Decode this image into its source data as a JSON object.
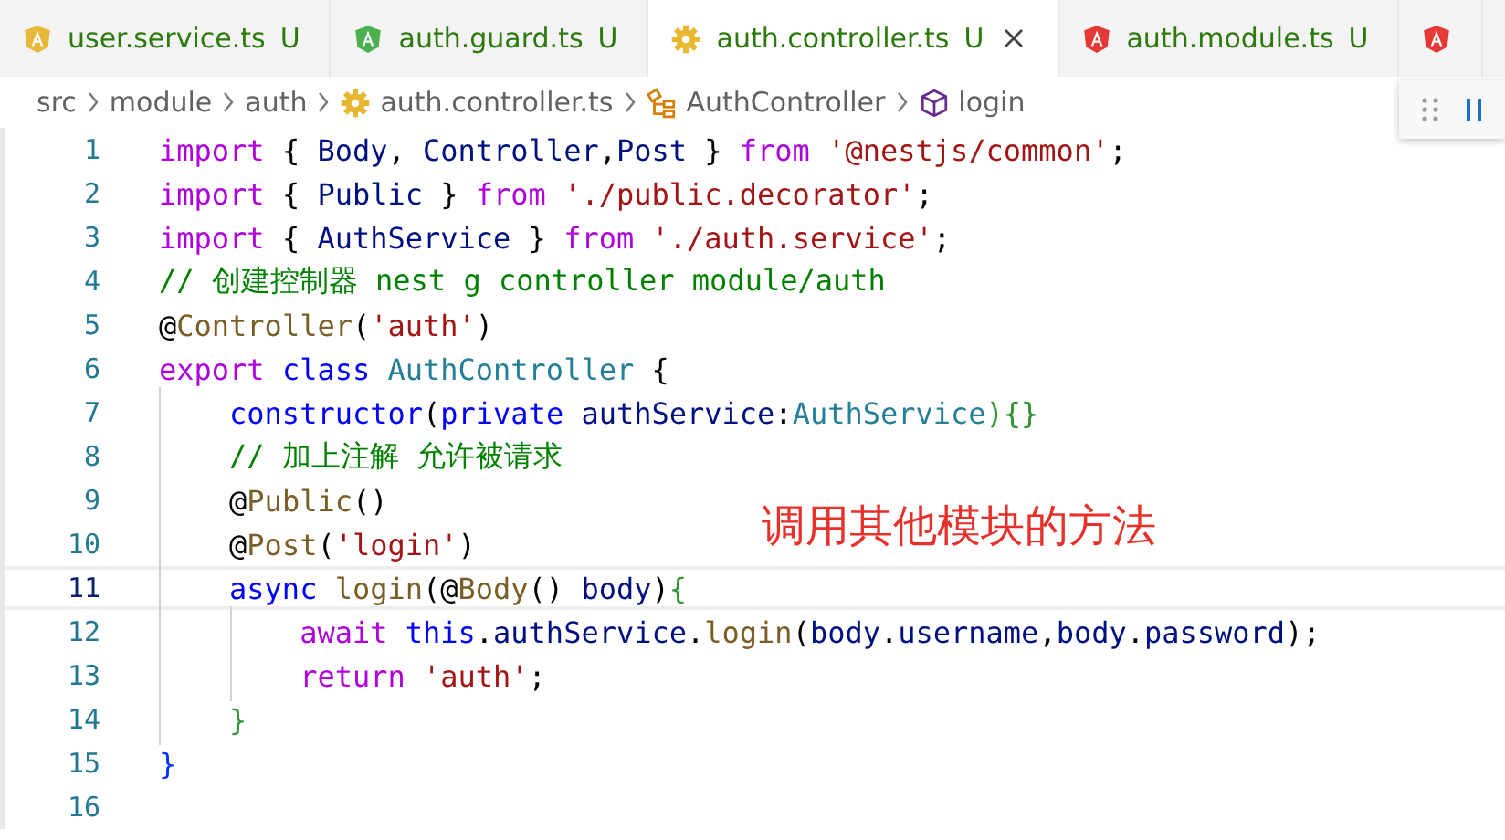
{
  "tabs": [
    {
      "label": "user.service.ts",
      "status": "U",
      "kind": "angular",
      "color": "#e8b73a",
      "selected": false
    },
    {
      "label": "auth.guard.ts",
      "status": "U",
      "kind": "angular",
      "color": "#4caf50",
      "selected": false
    },
    {
      "label": "auth.controller.ts",
      "status": "U",
      "kind": "gear",
      "color": "#e8b730",
      "selected": true
    },
    {
      "label": "auth.module.ts",
      "status": "U",
      "kind": "angular",
      "color": "#e53935",
      "selected": false
    },
    {
      "kind": "angular",
      "color": "#e53935",
      "selected": false
    }
  ],
  "breadcrumb": [
    {
      "label": "src",
      "kind": "folder"
    },
    {
      "label": "module",
      "kind": "folder"
    },
    {
      "label": "auth",
      "kind": "folder"
    },
    {
      "label": "auth.controller.ts",
      "kind": "file"
    },
    {
      "label": "AuthController",
      "kind": "class"
    },
    {
      "label": "login",
      "kind": "method"
    }
  ],
  "editor": {
    "lines": [
      {
        "number": "1",
        "active": false,
        "tokens": [
          {
            "text": "import ",
            "kind": "keyword"
          },
          {
            "text": "{ ",
            "kind": "plain"
          },
          {
            "text": "Body",
            "kind": "variable"
          },
          {
            "text": ", ",
            "kind": "plain"
          },
          {
            "text": "Controller",
            "kind": "variable"
          },
          {
            "text": ",",
            "kind": "plain"
          },
          {
            "text": "Post",
            "kind": "variable"
          },
          {
            "text": " } ",
            "kind": "plain"
          },
          {
            "text": "from ",
            "kind": "keyword"
          },
          {
            "text": "'@nestjs/common'",
            "kind": "string"
          },
          {
            "text": ";",
            "kind": "plain"
          }
        ]
      },
      {
        "number": "2",
        "active": false,
        "tokens": [
          {
            "text": "import ",
            "kind": "keyword"
          },
          {
            "text": "{ ",
            "kind": "plain"
          },
          {
            "text": "Public",
            "kind": "variable"
          },
          {
            "text": " } ",
            "kind": "plain"
          },
          {
            "text": "from ",
            "kind": "keyword"
          },
          {
            "text": "'./public.decorator'",
            "kind": "string"
          },
          {
            "text": ";",
            "kind": "plain"
          }
        ]
      },
      {
        "number": "3",
        "active": false,
        "tokens": [
          {
            "text": "import ",
            "kind": "keyword"
          },
          {
            "text": "{ ",
            "kind": "plain"
          },
          {
            "text": "AuthService",
            "kind": "variable"
          },
          {
            "text": " } ",
            "kind": "plain"
          },
          {
            "text": "from ",
            "kind": "keyword"
          },
          {
            "text": "'./auth.service'",
            "kind": "string"
          },
          {
            "text": ";",
            "kind": "plain"
          }
        ]
      },
      {
        "number": "4",
        "active": false,
        "tokens": [
          {
            "text": "// 创建控制器 nest g controller module/auth",
            "kind": "comment"
          }
        ]
      },
      {
        "number": "5",
        "active": false,
        "tokens": [
          {
            "text": "@",
            "kind": "plain"
          },
          {
            "text": "Controller",
            "kind": "function"
          },
          {
            "text": "(",
            "kind": "plain"
          },
          {
            "text": "'auth'",
            "kind": "string"
          },
          {
            "text": ")",
            "kind": "plain"
          }
        ]
      },
      {
        "number": "6",
        "active": false,
        "tokens": [
          {
            "text": "export ",
            "kind": "keyword"
          },
          {
            "text": "class ",
            "kind": "storage"
          },
          {
            "text": "AuthController",
            "kind": "type"
          },
          {
            "text": " {",
            "kind": "plain"
          }
        ]
      },
      {
        "number": "7",
        "active": false,
        "tokens": [
          {
            "text": "    constructor",
            "kind": "storage"
          },
          {
            "text": "(",
            "kind": "plain"
          },
          {
            "text": "private ",
            "kind": "storage"
          },
          {
            "text": "authService",
            "kind": "variable"
          },
          {
            "text": ":",
            "kind": "plain"
          },
          {
            "text": "AuthService",
            "kind": "type"
          },
          {
            "text": "){}",
            "kind": "brace"
          }
        ]
      },
      {
        "number": "8",
        "active": false,
        "tokens": [
          {
            "text": "    // 加上注解 允许被请求",
            "kind": "comment"
          }
        ]
      },
      {
        "number": "9",
        "active": false,
        "tokens": [
          {
            "text": "    @",
            "kind": "plain"
          },
          {
            "text": "Public",
            "kind": "function"
          },
          {
            "text": "()",
            "kind": "plain"
          }
        ]
      },
      {
        "number": "10",
        "active": false,
        "tokens": [
          {
            "text": "    @",
            "kind": "plain"
          },
          {
            "text": "Post",
            "kind": "function"
          },
          {
            "text": "(",
            "kind": "plain"
          },
          {
            "text": "'login'",
            "kind": "string"
          },
          {
            "text": ")",
            "kind": "plain"
          }
        ]
      },
      {
        "number": "11",
        "active": true,
        "tokens": [
          {
            "text": "    async ",
            "kind": "storage"
          },
          {
            "text": "login",
            "kind": "function"
          },
          {
            "text": "(@",
            "kind": "plain"
          },
          {
            "text": "Body",
            "kind": "function"
          },
          {
            "text": "() ",
            "kind": "plain"
          },
          {
            "text": "body",
            "kind": "variable"
          },
          {
            "text": ")",
            "kind": "plain"
          },
          {
            "text": "{",
            "kind": "brace"
          }
        ]
      },
      {
        "number": "12",
        "active": false,
        "tokens": [
          {
            "text": "        await ",
            "kind": "keyword"
          },
          {
            "text": "this",
            "kind": "storage"
          },
          {
            "text": ".",
            "kind": "plain"
          },
          {
            "text": "authService",
            "kind": "variable"
          },
          {
            "text": ".",
            "kind": "plain"
          },
          {
            "text": "login",
            "kind": "function"
          },
          {
            "text": "(",
            "kind": "plain"
          },
          {
            "text": "body",
            "kind": "variable"
          },
          {
            "text": ".",
            "kind": "plain"
          },
          {
            "text": "username",
            "kind": "variable"
          },
          {
            "text": ",",
            "kind": "plain"
          },
          {
            "text": "body",
            "kind": "variable"
          },
          {
            "text": ".",
            "kind": "plain"
          },
          {
            "text": "password",
            "kind": "variable"
          },
          {
            "text": ");",
            "kind": "plain"
          }
        ]
      },
      {
        "number": "13",
        "active": false,
        "tokens": [
          {
            "text": "        return ",
            "kind": "keyword"
          },
          {
            "text": "'auth'",
            "kind": "string"
          },
          {
            "text": ";",
            "kind": "plain"
          }
        ]
      },
      {
        "number": "14",
        "active": false,
        "tokens": [
          {
            "text": "    }",
            "kind": "brace"
          }
        ]
      },
      {
        "number": "15",
        "active": false,
        "tokens": [
          {
            "text": "}",
            "kind": "plainbrace"
          }
        ]
      },
      {
        "number": "16",
        "active": false
      }
    ]
  },
  "annotation": "调用其他模块的方法"
}
